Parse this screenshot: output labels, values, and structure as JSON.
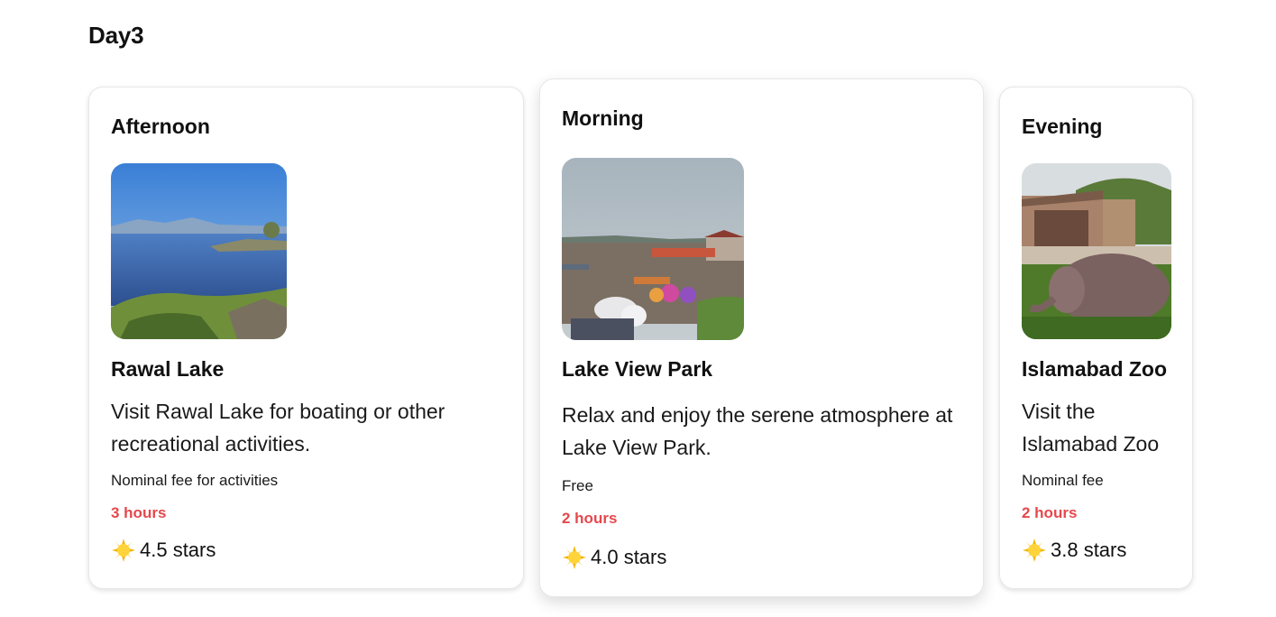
{
  "day": {
    "title": "Day3"
  },
  "colors": {
    "duration": "#e5484d",
    "card_border": "#e7e7e7",
    "sun": "#f5b400"
  },
  "cards": [
    {
      "slot": "Afternoon",
      "image_icon": "lake-photo",
      "name": "Rawal Lake",
      "description": "Visit Rawal Lake for boating or other recreational activities.",
      "cost": "Nominal fee for activities",
      "duration": "3 hours",
      "rating_icon": "sun-icon",
      "rating": "4.5 stars"
    },
    {
      "slot": "Morning",
      "image_icon": "lakeside-park-photo",
      "name": "Lake View Park",
      "description": "Relax and enjoy the serene atmosphere at Lake View Park.",
      "cost": "Free",
      "duration": "2 hours",
      "rating_icon": "sun-icon",
      "rating": "4.0 stars"
    },
    {
      "slot": "Evening",
      "image_icon": "zoo-elephant-photo",
      "name": "Islamabad Zoo",
      "description": "Visit the Islamabad Zoo",
      "cost": "Nominal fee",
      "duration": "2 hours",
      "rating_icon": "sun-icon",
      "rating": "3.8 stars"
    }
  ]
}
